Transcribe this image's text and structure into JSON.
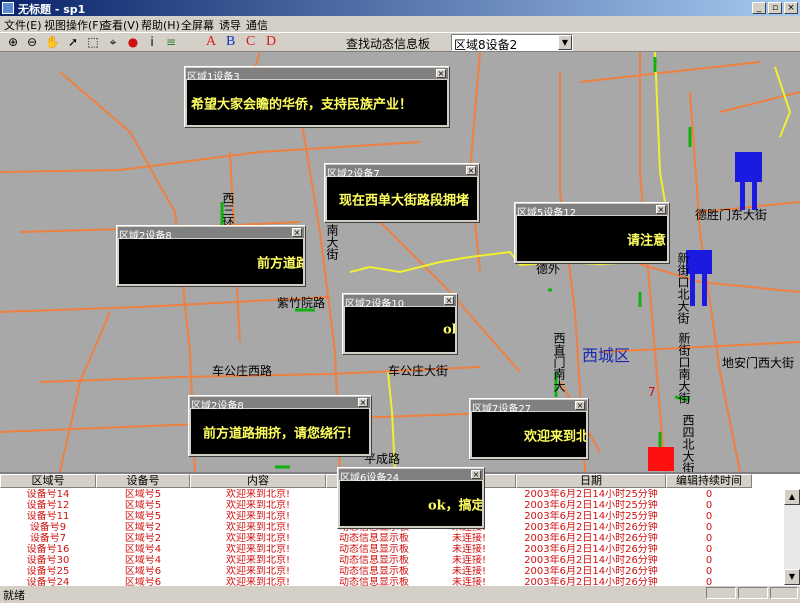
{
  "window": {
    "title": "无标题 - sp1"
  },
  "menu": [
    "文件(E)",
    "视图操作(F)",
    "查看(V)",
    "帮助(H)",
    "全屏幕",
    "诱导",
    "通信"
  ],
  "toolbar": {
    "letters": [
      "A",
      "B",
      "C",
      "D"
    ],
    "letter_colors": [
      "#e01818",
      "#1030c0",
      "#e01818",
      "#e01818"
    ],
    "find_label": "查找动态信息板",
    "area_select_value": "区域8设备2",
    "icons": [
      "zoom-in-icon",
      "zoom-out-icon",
      "hand-pan-icon",
      "arrow-pointer-icon",
      "select-pointer-icon",
      "query-pointer-icon",
      "alert-icon",
      "info-icon",
      "layers-icon"
    ]
  },
  "map": {
    "district": "西城区",
    "labels": [
      "德胜门东大街",
      "新街口北大街",
      "地安门西大街",
      "新街口南大街",
      "西四北大街",
      "车公庄西路",
      "车公庄大街",
      "紫竹院路",
      "西直门南大街",
      "南大街",
      "西三环",
      "平成路",
      "德外",
      "7"
    ],
    "sign_colors": {
      "blue": "#1a1ae0",
      "red": "#ff1010",
      "green": "#10b010",
      "road": "#f08040",
      "yellow": "#f0f030"
    }
  },
  "popups": [
    {
      "title": "区域1设备3",
      "text": "希望大家会瞻的华侨，支持民族产业！"
    },
    {
      "title": "区域2设备7",
      "text": "现在西单大街路段拥堵"
    },
    {
      "title": "区域5设备12",
      "text": "请注意"
    },
    {
      "title": "区域2设备8",
      "text": "前方道路"
    },
    {
      "title": "区域2设备10",
      "text": "ok"
    },
    {
      "title": "区域2设备8",
      "text": "前方道路拥挤，请您绕行！"
    },
    {
      "title": "区域7设备27",
      "text": "欢迎来到北"
    },
    {
      "title": "区域6设备24",
      "text": "ok，搞定了"
    }
  ],
  "table": {
    "headers": [
      "区域号",
      "设备号",
      "内容",
      "",
      "",
      "日期",
      "编辑持续时间"
    ],
    "rows": [
      [
        "设备号14",
        "区域号5",
        "欢迎来到北京!",
        "动态信息显示板",
        "未连接!",
        "2003年6月2日14小时25分钟",
        "0"
      ],
      [
        "设备号12",
        "区域号5",
        "欢迎来到北京!",
        "动态信息显示板",
        "未连接!",
        "2003年6月2日14小时25分钟",
        "0"
      ],
      [
        "设备号11",
        "区域号5",
        "欢迎来到北京!",
        "动态信息显示板",
        "未连接!",
        "2003年6月2日14小时25分钟",
        "0"
      ],
      [
        "设备号9",
        "区域号2",
        "欢迎来到北京!",
        "动态信息显示板",
        "未连接!",
        "2003年6月2日14小时26分钟",
        "0"
      ],
      [
        "设备号7",
        "区域号2",
        "欢迎来到北京!",
        "动态信息显示板",
        "未连接!",
        "2003年6月2日14小时26分钟",
        "0"
      ],
      [
        "设备号16",
        "区域号4",
        "欢迎来到北京!",
        "动态信息显示板",
        "未连接!",
        "2003年6月2日14小时26分钟",
        "0"
      ],
      [
        "设备号30",
        "区域号4",
        "欢迎来到北京!",
        "动态信息显示板",
        "未连接!",
        "2003年6月2日14小时26分钟",
        "0"
      ],
      [
        "设备号25",
        "区域号6",
        "欢迎来到北京!",
        "动态信息显示板",
        "未连接!",
        "2003年6月2日14小时26分钟",
        "0"
      ],
      [
        "设备号24",
        "区域号6",
        "欢迎来到北京!",
        "动态信息显示板",
        "未连接!",
        "2003年6月2日14小时26分钟",
        "0"
      ]
    ]
  },
  "status": {
    "text": "就绪"
  }
}
